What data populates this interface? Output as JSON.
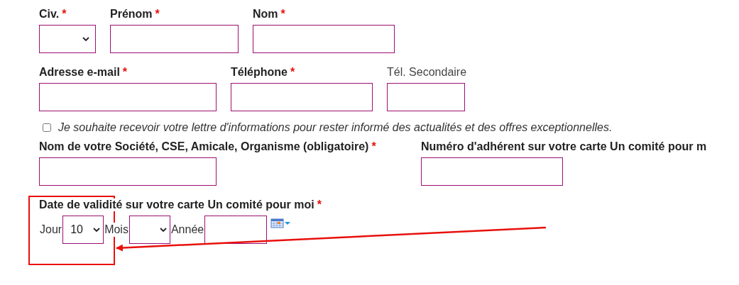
{
  "rows": [
    {
      "fields": [
        {
          "label": "Civ.",
          "bold": true,
          "asterisk": "*",
          "kind": "select"
        },
        {
          "label": "Prénom",
          "bold": true,
          "asterisk": "*",
          "kind": "text"
        },
        {
          "label": "Nom",
          "bold": true,
          "asterisk": "*",
          "kind": "text"
        }
      ]
    },
    {
      "fields": [
        {
          "label": "Adresse e-mail",
          "bold": true,
          "asterisk": "*",
          "kind": "text"
        },
        {
          "label": "Téléphone",
          "bold": true,
          "asterisk": "*",
          "kind": "text"
        },
        {
          "label": "Tél. Secondaire",
          "bold": false,
          "kind": "text"
        }
      ]
    }
  ],
  "newsletter": {
    "checked": false,
    "label": "Je souhaite recevoir votre lettre d'informations pour rester informé des actualités et des offres exceptionnelles."
  },
  "company_row": {
    "fields": [
      {
        "label": "Nom de votre Société, CSE, Amicale, Organisme (obligatoire)",
        "bold": true,
        "asterisk": "*",
        "kind": "text"
      },
      {
        "label": "Numéro d'adhérent sur votre carte Un comité pour m",
        "bold": true,
        "kind": "text"
      }
    ]
  },
  "validity_date": {
    "label": "Date de validité sur votre carte Un comité pour moi",
    "asterisk": "*",
    "parts": [
      {
        "label": "Jour",
        "kind": "select",
        "value": "10"
      },
      {
        "label": "Mois",
        "kind": "select"
      },
      {
        "label": "Année",
        "kind": "text"
      }
    ]
  }
}
